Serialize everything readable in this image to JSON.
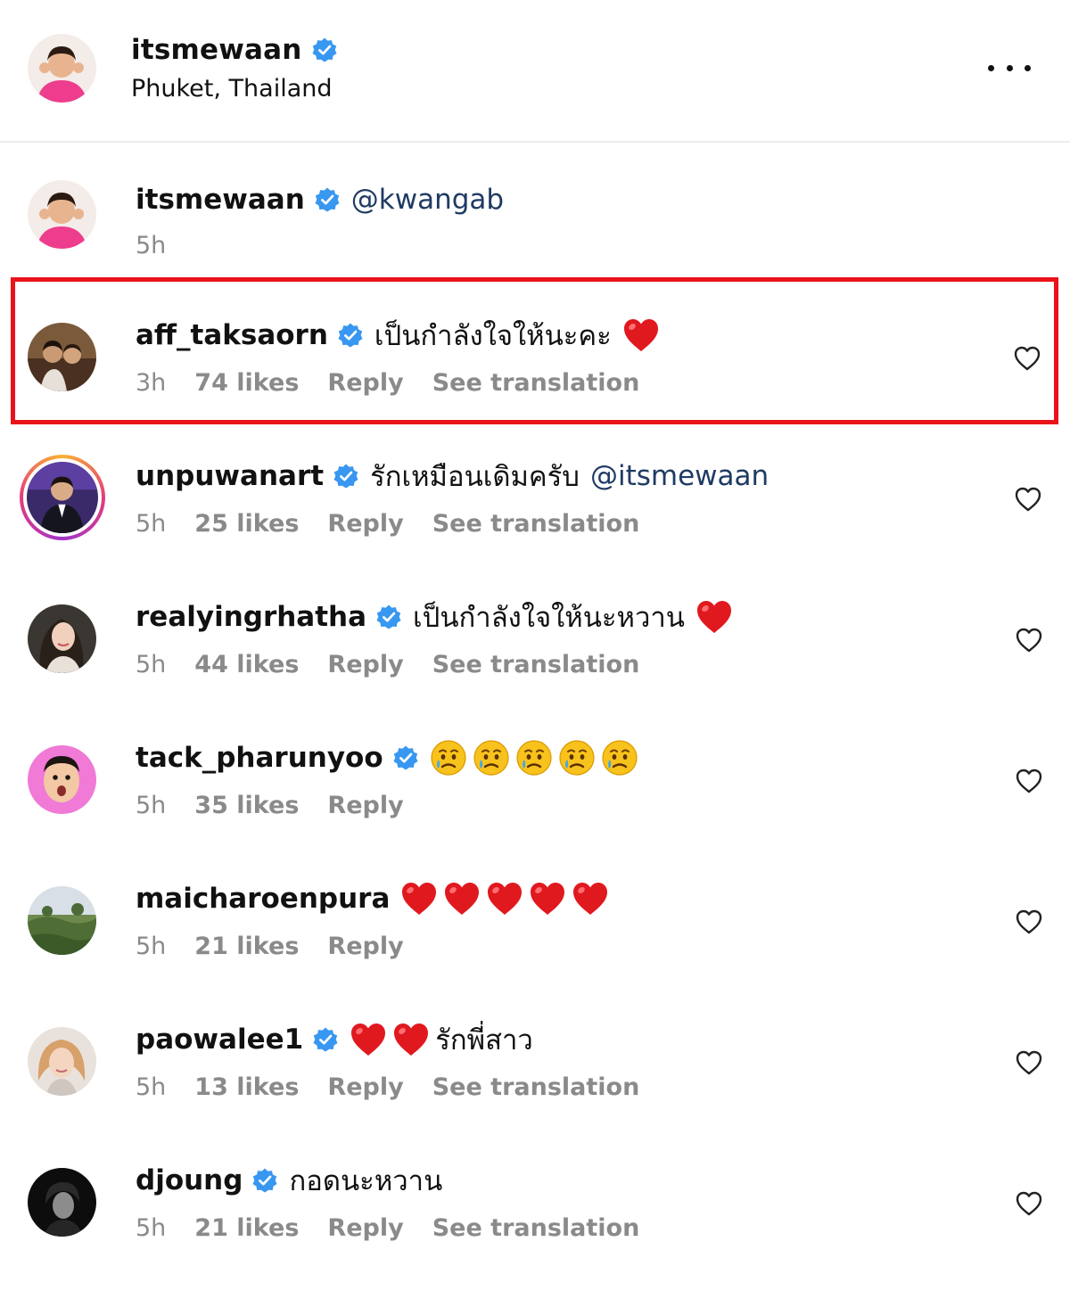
{
  "post": {
    "username": "itsmewaan",
    "location": "Phuket, Thailand"
  },
  "comments": [
    {
      "username": "itsmewaan",
      "verified": true,
      "mention": "@kwangab",
      "time": "5h"
    },
    {
      "username": "aff_taksaorn",
      "verified": true,
      "text": "เป็นกำลังใจให้นะคะ",
      "emoji": [
        "red-heart"
      ],
      "time": "3h",
      "likes": "74 likes",
      "reply": "Reply",
      "translate": "See translation",
      "highlighted": true
    },
    {
      "username": "unpuwanart",
      "verified": true,
      "text": "รักเหมือนเดิมครับ",
      "mention": "@itsmewaan",
      "time": "5h",
      "likes": "25 likes",
      "reply": "Reply",
      "translate": "See translation"
    },
    {
      "username": "realyingrhatha",
      "verified": true,
      "text": "เป็นกำลังใจให้นะหวาน",
      "emoji": [
        "red-heart"
      ],
      "time": "5h",
      "likes": "44 likes",
      "reply": "Reply",
      "translate": "See translation"
    },
    {
      "username": "tack_pharunyoo",
      "verified": true,
      "emoji": [
        "crying-face",
        "crying-face",
        "crying-face",
        "crying-face",
        "crying-face"
      ],
      "time": "5h",
      "likes": "35 likes",
      "reply": "Reply"
    },
    {
      "username": "maicharoenpura",
      "verified": false,
      "emoji": [
        "red-heart",
        "red-heart",
        "red-heart",
        "red-heart",
        "red-heart"
      ],
      "time": "5h",
      "likes": "21 likes",
      "reply": "Reply"
    },
    {
      "username": "paowalee1",
      "verified": true,
      "emoji": [
        "red-heart",
        "red-heart"
      ],
      "text": "รักพี่สาว",
      "time": "5h",
      "likes": "13 likes",
      "reply": "Reply",
      "translate": "See translation"
    },
    {
      "username": "djoung",
      "verified": true,
      "text": "กอดนะหวาน",
      "time": "5h",
      "likes": "21 likes",
      "reply": "Reply",
      "translate": "See translation"
    }
  ],
  "colors": {
    "verified": "#3897f0",
    "mention": "#1f3b63",
    "meta": "#8a8a8a",
    "highlight": "#e8141a",
    "heart": "#e0191f"
  }
}
